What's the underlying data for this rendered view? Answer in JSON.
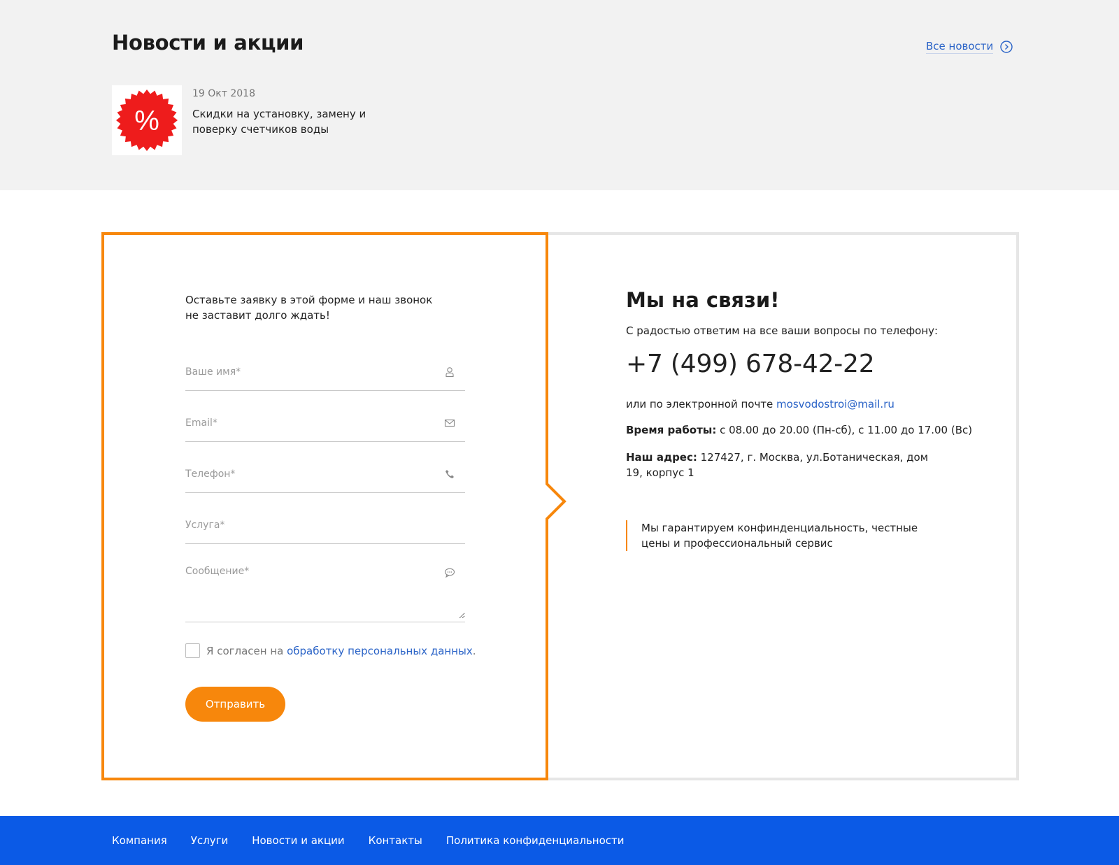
{
  "news": {
    "title": "Новости и акции",
    "all_news_label": "Все новости",
    "items": [
      {
        "date": "19 Окт 2018",
        "text": "Скидки на установку, замену и поверку счетчиков воды",
        "thumb_symbol": "%"
      }
    ]
  },
  "form": {
    "intro": "Оставьте заявку в этой форме и наш звонок не заставит долго ждать!",
    "name_placeholder": "Ваше имя*",
    "email_placeholder": "Email*",
    "phone_placeholder": "Телефон*",
    "service_placeholder": "Услуга*",
    "message_placeholder": "Сообщение*",
    "consent_prefix": "Я согласен на ",
    "consent_link": "обработку персональных данных",
    "consent_suffix": ".",
    "submit_label": "Отправить"
  },
  "contact": {
    "heading": "Мы на связи!",
    "sub": "С радостью ответим на все ваши вопросы по телефону:",
    "phone": "+7 (499) 678-42-22",
    "email_prefix": "или по электронной почте ",
    "email": "mosvodostroi@mail.ru",
    "hours_label": "Время работы:",
    "hours_value": " с 08.00 до 20.00 (Пн-сб), с 11.00 до 17.00 (Вс)",
    "address_label": "Наш адрес:",
    "address_value": " 127427, г. Москва, ул.Ботаническая, дом 19, корпус 1",
    "guarantee": "Мы гарантируем конфинденциальность, честные цены и профессиональный сервис"
  },
  "footer": {
    "links": [
      "Компания",
      "Услуги",
      "Новости и акции",
      "Контакты",
      "Политика конфиденциальности"
    ]
  },
  "colors": {
    "accent": "#f7870c",
    "link": "#2a63c7",
    "footer_bg": "#0b5ae6",
    "news_bg": "#f2f2f2",
    "badge": "#ee1c1c"
  }
}
